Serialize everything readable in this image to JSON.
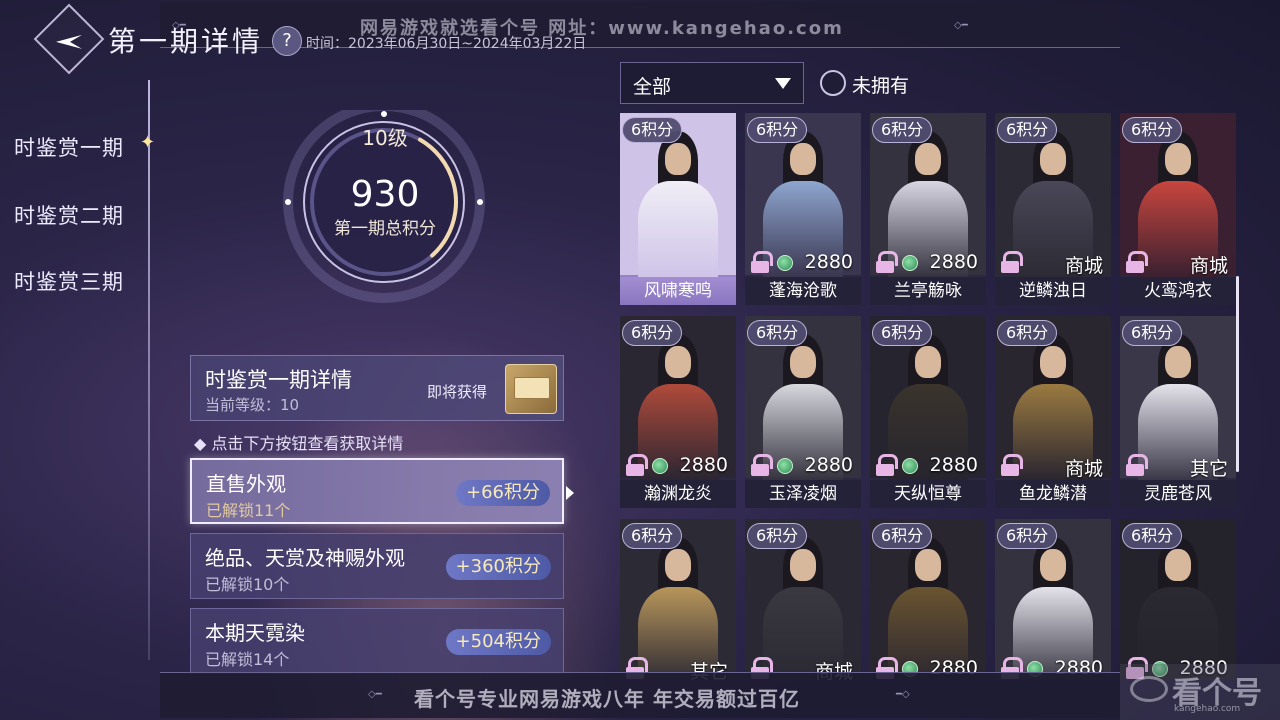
{
  "header": {
    "title": "第一期详情",
    "help_symbol": "?",
    "time_range": "时间：2023年06月30日~2024年03月22日",
    "watermark": "网易游戏就选看个号  网址：www.kangehao.com"
  },
  "sidebar": {
    "items": [
      {
        "label": "时鉴赏一期"
      },
      {
        "label": "时鉴赏二期"
      },
      {
        "label": "时鉴赏三期"
      }
    ]
  },
  "level_ring": {
    "level": "10级",
    "score": "930",
    "caption": "第一期总积分",
    "progress": 0.3
  },
  "detail": {
    "title": "时鉴赏一期详情",
    "current_level": "当前等级：10",
    "coming_soon": "即将获得"
  },
  "hint": "◆ 点击下方按钮查看获取详情",
  "sources": [
    {
      "title": "直售外观",
      "unlocked": "已解锁11个",
      "points": "+66积分"
    },
    {
      "title": "绝品、天赏及神赐外观",
      "unlocked": "已解锁10个",
      "points": "+360积分"
    },
    {
      "title": "本期天霓染",
      "unlocked": "已解锁14个",
      "points": "+504积分"
    }
  ],
  "filter": {
    "selected": "全部",
    "unowned_label": "未拥有"
  },
  "outfits": [
    {
      "badge": "6积分",
      "price": "",
      "currency": "none",
      "name": "风啸寒鸣",
      "colors": [
        "#cfc4e8",
        "#f0eef6"
      ]
    },
    {
      "badge": "6积分",
      "price": "2880",
      "currency": "jade",
      "name": "蓬海沧歌",
      "colors": [
        "#3a3650",
        "#8ea6cf"
      ]
    },
    {
      "badge": "6积分",
      "price": "2880",
      "currency": "jade",
      "name": "兰亭觞咏",
      "colors": [
        "#34323e",
        "#d8d6e2"
      ]
    },
    {
      "badge": "6积分",
      "price": "商城",
      "currency": "shop",
      "name": "逆鳞浊日",
      "colors": [
        "#2c2a34",
        "#4a4858"
      ]
    },
    {
      "badge": "6积分",
      "price": "商城",
      "currency": "shop",
      "name": "火鸾鸿衣",
      "colors": [
        "#3a2030",
        "#c8463e"
      ]
    },
    {
      "badge": "6积分",
      "price": "2880",
      "currency": "jade",
      "name": "瀚渊龙炎",
      "colors": [
        "#2a2632",
        "#b04a3a"
      ]
    },
    {
      "badge": "6积分",
      "price": "2880",
      "currency": "jade",
      "name": "玉泽凌烟",
      "colors": [
        "#34323e",
        "#d6d8de"
      ]
    },
    {
      "badge": "6积分",
      "price": "2880",
      "currency": "jade",
      "name": "天纵恒尊",
      "colors": [
        "#26242e",
        "#3a342c"
      ]
    },
    {
      "badge": "6积分",
      "price": "商城",
      "currency": "shop",
      "name": "鱼龙鳞潜",
      "colors": [
        "#2a2630",
        "#9a7a40"
      ]
    },
    {
      "badge": "6积分",
      "price": "其它",
      "currency": "shop",
      "name": "灵鹿苍风",
      "colors": [
        "#3a3848",
        "#e4e2ea"
      ]
    },
    {
      "badge": "6积分",
      "price": "其它",
      "currency": "shop",
      "name": "",
      "colors": [
        "#2c2a34",
        "#b8965a"
      ]
    },
    {
      "badge": "6积分",
      "price": "商城",
      "currency": "shop",
      "name": "",
      "colors": [
        "#2a2832",
        "#3a3840"
      ]
    },
    {
      "badge": "6积分",
      "price": "2880",
      "currency": "jade",
      "name": "",
      "colors": [
        "#2a2630",
        "#6a5430"
      ]
    },
    {
      "badge": "6积分",
      "price": "2880",
      "currency": "jade",
      "name": "",
      "colors": [
        "#34323e",
        "#e4e2ea"
      ]
    },
    {
      "badge": "6积分",
      "price": "2880",
      "currency": "jade",
      "name": "",
      "colors": [
        "#24222a",
        "#2a2830"
      ]
    }
  ],
  "footer": {
    "ad": "看个号专业网易游戏八年  年交易额过百亿",
    "logo_text": "看个号",
    "logo_url": "kangehao.com"
  }
}
